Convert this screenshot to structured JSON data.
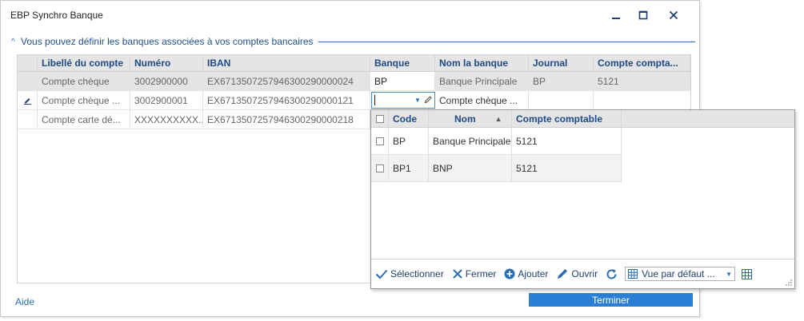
{
  "window": {
    "title": "EBP Synchro Banque"
  },
  "group": {
    "caret": "^",
    "label": "Vous pouvez définir les banques associées à vos comptes bancaires"
  },
  "grid": {
    "columns": [
      "Libellé du compte",
      "Numéro",
      "IBAN",
      "Banque",
      "Nom la banque",
      "Journal",
      "Compte compta..."
    ],
    "rows": [
      {
        "libelle": "Compte chèque",
        "numero": "3002900000",
        "iban": "EX6713507257946300290000024",
        "banque": "BP",
        "nom_banque": "Banque Principale",
        "journal": "BP",
        "compte": "5121"
      },
      {
        "libelle": "Compte chèque ...",
        "numero": "3002900001",
        "iban": "EX6713507257946300290000121",
        "banque": "",
        "nom_banque": "Compte chèque ...",
        "journal": "",
        "compte": ""
      },
      {
        "libelle": "Compte carte dé...",
        "numero": "XXXXXXXXXX...",
        "iban": "EX6713507257946300290000218",
        "banque": "",
        "nom_banque": "",
        "journal": "",
        "compte": ""
      }
    ]
  },
  "popup": {
    "columns": [
      "Code",
      "Nom",
      "Compte comptable"
    ],
    "rows": [
      {
        "code": "BP",
        "nom": "Banque Principale",
        "compte": "5121"
      },
      {
        "code": "BP1",
        "nom": "BNP",
        "compte": "5121"
      }
    ],
    "toolbar": {
      "select_label": "Sélectionner",
      "close_label": "Fermer",
      "add_label": "Ajouter",
      "open_label": "Ouvrir",
      "view_value": "Vue par défaut ..."
    }
  },
  "footer": {
    "help_label": "Aide",
    "finish_label": "Terminer"
  },
  "colors": {
    "accent": "#2a7fd4",
    "header_text": "#1f4a86",
    "link": "#2b6cb5"
  }
}
